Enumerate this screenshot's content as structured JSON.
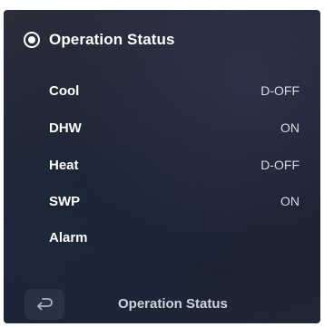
{
  "header": {
    "title": "Operation Status",
    "icon": "radio-selected-icon"
  },
  "rows": [
    {
      "label": "Cool",
      "value": "D-OFF"
    },
    {
      "label": "DHW",
      "value": "ON"
    },
    {
      "label": "Heat",
      "value": "D-OFF"
    },
    {
      "label": "SWP",
      "value": "ON"
    },
    {
      "label": "Alarm",
      "value": ""
    }
  ],
  "footer": {
    "back_icon": "return-arrow-icon",
    "title": "Operation Status"
  },
  "colors": {
    "background": "#1c2431",
    "text": "#ffffff",
    "value_text": "#d9dbe1"
  }
}
